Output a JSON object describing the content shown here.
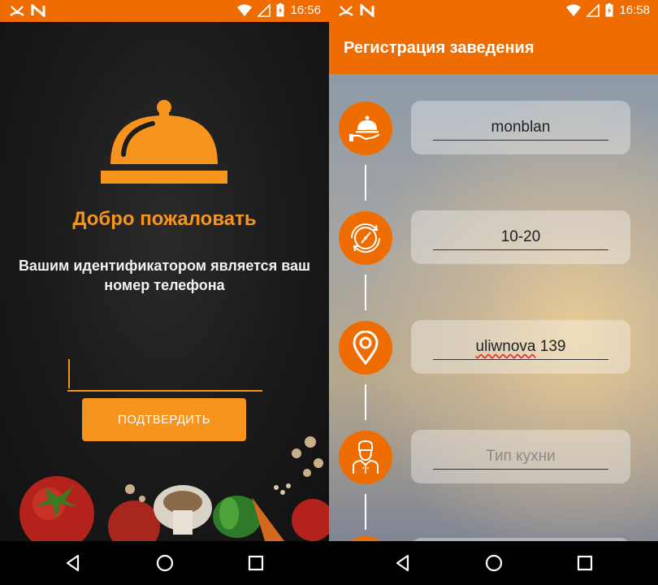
{
  "left_screen": {
    "status_time": "16:56",
    "welcome_title": "Добро пожаловать",
    "identifier_text": "Вашим идентификатором является ваш номер телефона",
    "phone_input": {
      "value": "",
      "placeholder": ""
    },
    "confirm_label": "ПОДТВЕРДИТЬ"
  },
  "right_screen": {
    "status_time": "16:58",
    "title": "Регистрация заведения",
    "fields": [
      {
        "icon": "waiter-cloche-icon",
        "value": "monblan",
        "placeholder": ""
      },
      {
        "icon": "clock-time-icon",
        "value": "10-20",
        "placeholder": ""
      },
      {
        "icon": "location-pin-icon",
        "value_word": "uliwnova",
        "value_rest": " 139",
        "placeholder": ""
      },
      {
        "icon": "chef-icon",
        "value": "",
        "placeholder": "Тип кухни"
      }
    ]
  },
  "colors": {
    "accent": "#ef6c00",
    "button": "#f7941d",
    "text_light": "#f2f2f2"
  }
}
